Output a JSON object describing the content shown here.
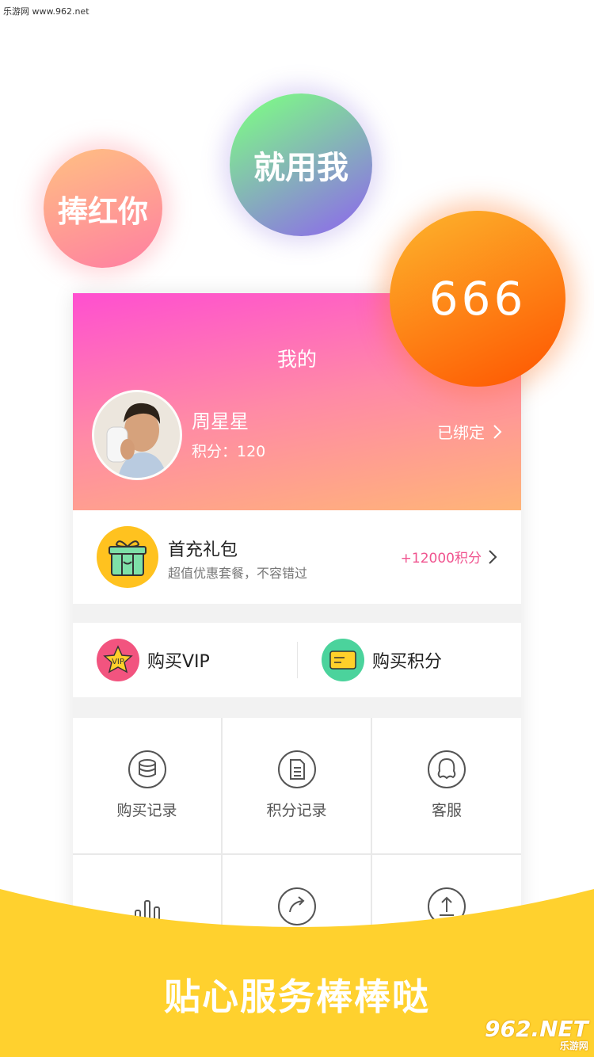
{
  "watermark": "乐游网 www.962.net",
  "bubbles": {
    "left": "捧红你",
    "middle": "就用我",
    "right": "666"
  },
  "profile": {
    "title": "我的",
    "user_name": "周星星",
    "points_label": "积分：120",
    "bind_status": "已绑定"
  },
  "gift": {
    "title": "首充礼包",
    "subtitle": "超值优惠套餐，不容错过",
    "reward": "+12000积分"
  },
  "purchase": {
    "vip": "购买VIP",
    "points": "购买积分",
    "vip_badge": "VIP"
  },
  "grid": [
    {
      "label": "购买记录",
      "icon": "coins-icon"
    },
    {
      "label": "积分记录",
      "icon": "document-icon"
    },
    {
      "label": "客服",
      "icon": "support-icon"
    },
    {
      "label": "",
      "icon": "bar-chart-icon"
    },
    {
      "label": "",
      "icon": "share-icon"
    },
    {
      "label": "",
      "icon": "upload-icon"
    }
  ],
  "slogan": "贴心服务棒棒哒",
  "logo": {
    "main": "962.NET",
    "sub": "乐游网"
  },
  "colors": {
    "banner": "#ffd12e",
    "pink": "#ff4fd0",
    "accent": "#f0548f"
  }
}
